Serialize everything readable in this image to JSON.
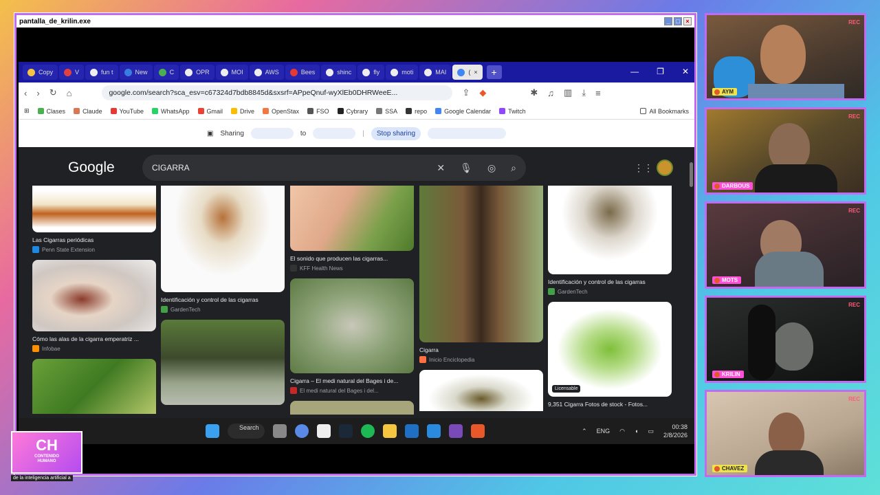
{
  "window": {
    "title": "pantalla_de_krilin.exe"
  },
  "browser": {
    "tabs": [
      {
        "label": "Copy",
        "color": "#f5c542"
      },
      {
        "label": "V",
        "color": "#e04040"
      },
      {
        "label": "fun t",
        "color": "#eeeeee"
      },
      {
        "label": "New",
        "color": "#3a7de0"
      },
      {
        "label": "C",
        "color": "#4caf50"
      },
      {
        "label": "OPR",
        "color": "#eeeeee"
      },
      {
        "label": "MOI",
        "color": "#eeeeee"
      },
      {
        "label": "AWS",
        "color": "#eeeeee"
      },
      {
        "label": "Bees",
        "color": "#e53935"
      },
      {
        "label": "shinc",
        "color": "#eeeeee"
      },
      {
        "label": "fly",
        "color": "#eeeeee"
      },
      {
        "label": "moti",
        "color": "#eeeeee"
      },
      {
        "label": "MAI",
        "color": "#eeeeee"
      },
      {
        "label": "(",
        "color": "#cccccc"
      }
    ],
    "url": "google.com/search?sca_esv=c67324d7bdb8845d&sxsrf=APpeQnuf-wyXlEb0DHRWeeE...",
    "bookmarks": [
      {
        "label": "Clases",
        "color": "#4caf50"
      },
      {
        "label": "Claude",
        "color": "#d97757"
      },
      {
        "label": "YouTube",
        "color": "#e53935"
      },
      {
        "label": "WhatsApp",
        "color": "#25d366"
      },
      {
        "label": "Gmail",
        "color": "#ea4335"
      },
      {
        "label": "Drive",
        "color": "#fbbc04"
      },
      {
        "label": "OpenStax",
        "color": "#f47641"
      },
      {
        "label": "FSO",
        "color": "#555555"
      },
      {
        "label": "Cybrary",
        "color": "#222222"
      },
      {
        "label": "SSA",
        "color": "#777777"
      },
      {
        "label": "repo",
        "color": "#333333"
      },
      {
        "label": "Google Calendar",
        "color": "#4285f4"
      },
      {
        "label": "Twitch",
        "color": "#9146ff"
      }
    ],
    "all_bookmarks": "All Bookmarks",
    "share_bar": {
      "sharing": "Sharing",
      "to": "to",
      "stop": "Stop sharing"
    }
  },
  "google": {
    "logo": "Google",
    "query": "CIGARRA",
    "results": [
      {
        "caption": "Las Cigarras periódicas",
        "source": "Penn State Extension",
        "color": "#1e88e5"
      },
      {
        "caption": "Cómo las alas de la cigarra emperatriz ...",
        "source": "Infobae",
        "color": "#ff8f00"
      },
      {
        "caption": "Identificación y control de las cigarras",
        "source": "GardenTech",
        "color": "#43a047"
      },
      {
        "caption": "El sonido que producen las cigarras...",
        "source": "KFF Health News",
        "color": "#333333"
      },
      {
        "caption": "Cigarra – El medi natural del Bages i de...",
        "source": "El medi natural del Bages i del...",
        "color": "#c62828"
      },
      {
        "caption": "Cigarra",
        "source": "Inicio Enciclopedia",
        "color": "#ff7043"
      },
      {
        "caption": "Identificación y control de las cigarras",
        "source": "GardenTech",
        "color": "#43a047"
      },
      {
        "caption": "9,351 Cigarra Fotos de stock - Fotos...",
        "source": "",
        "color": "#555555"
      }
    ],
    "license_badge": "Licensable"
  },
  "taskbar": {
    "search": "Search",
    "lang": "ENG",
    "time": "00:38",
    "date": "2/8/2026"
  },
  "brand": {
    "logo": "CH",
    "line1": "CONTENIDO",
    "line2": "HUMANO",
    "subtitle": "de la inteligencia artificial a"
  },
  "cams": [
    {
      "name": "AYM",
      "rec": "REC"
    },
    {
      "name": "DARBOUS",
      "rec": "REC"
    },
    {
      "name": "MOTS",
      "rec": "REC"
    },
    {
      "name": "KRILIN",
      "rec": "REC"
    },
    {
      "name": "CHAVEZ",
      "rec": "REC"
    }
  ]
}
